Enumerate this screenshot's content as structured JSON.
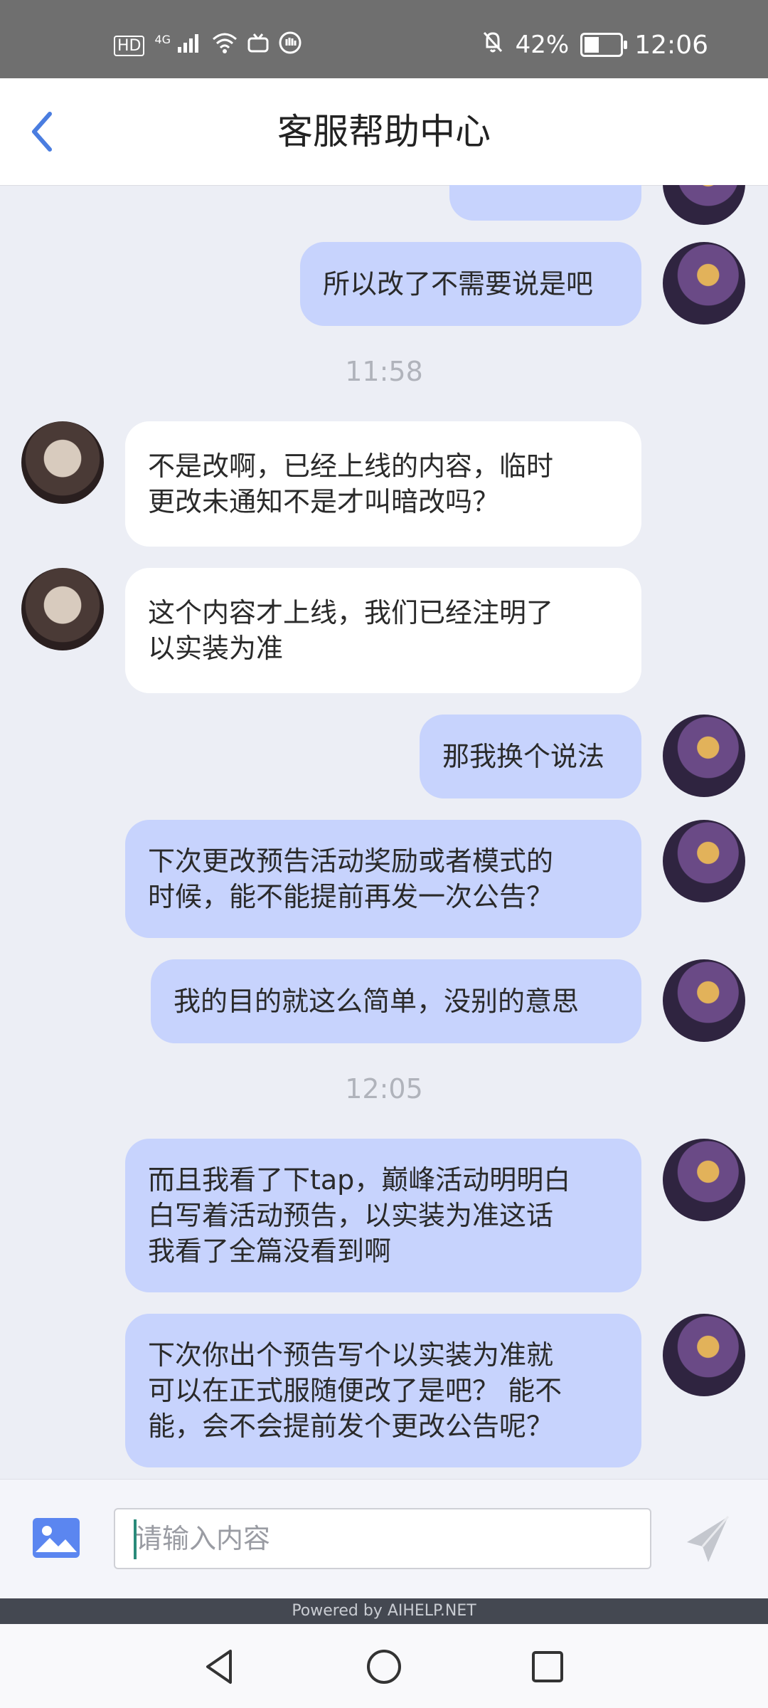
{
  "status_bar": {
    "network": "HD",
    "signal": "4G",
    "battery_percent": "42%",
    "battery_level": 0.42,
    "time": "12:06"
  },
  "header": {
    "title": "客服帮助中心"
  },
  "messages": [
    {
      "sender": "user",
      "text": "所以改了不需要说是吧"
    },
    {
      "type": "timestamp",
      "text": "11:58"
    },
    {
      "sender": "agent",
      "text": "不是改啊，已经上线的内容，临时\n更改未通知不是才叫暗改吗？"
    },
    {
      "sender": "agent",
      "text": "这个内容才上线，我们已经注明了\n以实装为准"
    },
    {
      "sender": "user",
      "text": "那我换个说法"
    },
    {
      "sender": "user",
      "text": "下次更改预告活动奖励或者模式的\n时候，能不能提前再发一次公告？"
    },
    {
      "sender": "user",
      "text": "我的目的就这么简单，没别的意思"
    },
    {
      "type": "timestamp",
      "text": "12:05"
    },
    {
      "sender": "user",
      "text": "而且我看了下tap，巅峰活动明明白\n白写着活动预告，以实装为准这话\n我看了全篇没看到啊"
    },
    {
      "sender": "user",
      "text": "下次你出个预告写个以实装为准就\n可以在正式服随便改了是吧？ 能不\n能，会不会提前发个更改公告呢？"
    }
  ],
  "input": {
    "placeholder": "请输入内容",
    "value": ""
  },
  "footer": {
    "powered_by": "Powered by AIHELP.NET"
  },
  "colors": {
    "accent": "#4a7de0",
    "user_bubble": "#c7d3fd",
    "agent_bubble": "#ffffff",
    "background": "#eceef5"
  }
}
